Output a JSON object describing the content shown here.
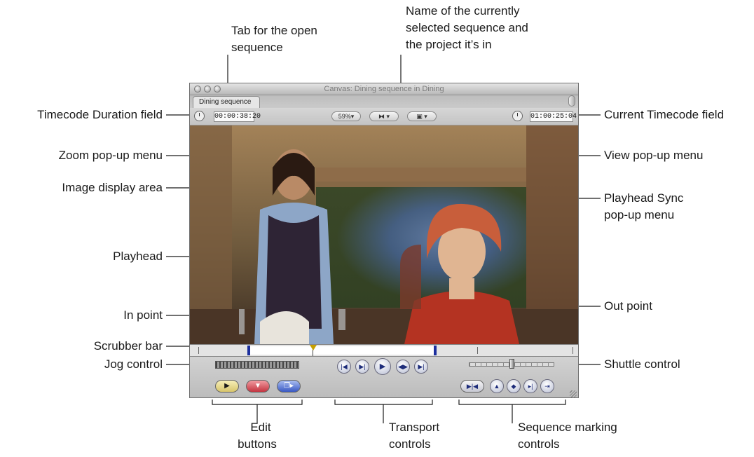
{
  "window": {
    "title": "Canvas: Dining sequence in Dining",
    "tab_label": "Dining sequence",
    "timecode_duration": "00:00:38:20",
    "current_timecode": "01:00:25:04",
    "zoom_value": "59%"
  },
  "callouts": {
    "tab_open_sequence": [
      "Tab for the open",
      "sequence"
    ],
    "sequence_name": [
      "Name of the currently",
      "selected sequence and",
      "the project it’s in"
    ],
    "timecode_duration_field": "Timecode Duration field",
    "current_timecode_field": "Current Timecode field",
    "zoom_popup": "Zoom pop-up menu",
    "view_popup": "View pop-up menu",
    "image_display_area": "Image display area",
    "playhead_sync": [
      "Playhead Sync",
      "pop-up menu"
    ],
    "playhead": "Playhead",
    "in_point": "In point",
    "out_point": "Out point",
    "scrubber_bar": "Scrubber bar",
    "jog_control": "Jog control",
    "shuttle_control": "Shuttle control",
    "edit_buttons": [
      "Edit",
      "buttons"
    ],
    "transport_controls": [
      "Transport",
      "controls"
    ],
    "sequence_marking_controls": [
      "Sequence marking",
      "controls"
    ]
  },
  "icons": {
    "transport": [
      "go-to-previous-edit-icon",
      "play-in-to-out-icon",
      "play-icon",
      "play-around-current-icon",
      "go-to-next-edit-icon"
    ],
    "marking": [
      "mark-in-out-icon",
      "add-marker-icon",
      "add-keyframe-icon",
      "mark-clip-icon",
      "match-frame-icon"
    ],
    "edit": [
      "insert-edit-icon",
      "overwrite-edit-icon",
      "replace-edit-icon"
    ]
  },
  "colors": {
    "scrubber_marks": "#1c2f9e",
    "playhead": "#c7a000",
    "insert_button": "#e3d27b",
    "overwrite_button": "#cf3b43",
    "replace_button": "#3d5fc9"
  }
}
